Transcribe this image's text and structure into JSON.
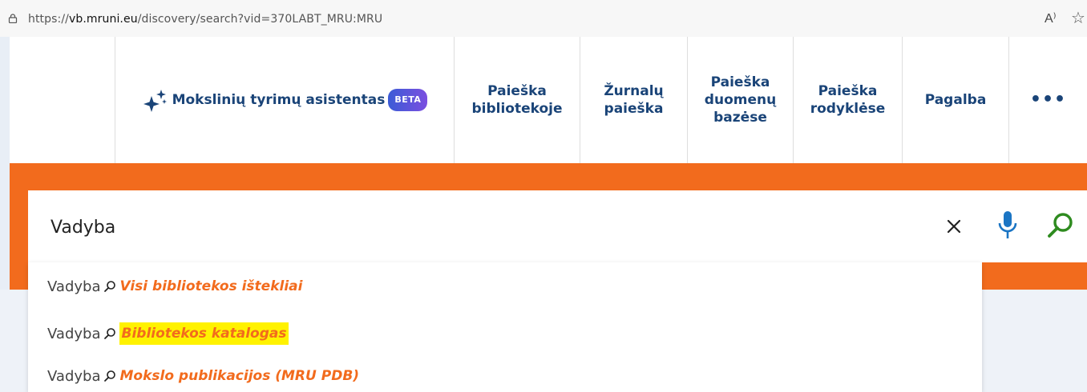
{
  "browser": {
    "url_prefix": "https://",
    "url_host": "vb.mruni.eu",
    "url_path": "/discovery/search?vid=370LABT_MRU:MRU",
    "read_aloud": "A⁾",
    "favorite": "☆"
  },
  "nav": {
    "ai_label": "Mokslinių tyrimų asistentas",
    "beta": "BETA",
    "items": [
      {
        "label": "Paieška\nbibliotekoje"
      },
      {
        "label": "Žurnalų\npaieška"
      },
      {
        "label": "Paieška\nduomenų\nbazėse"
      },
      {
        "label": "Paieška\nrodyklėse"
      },
      {
        "label": "Pagalba"
      }
    ],
    "more": "•••"
  },
  "search": {
    "value": "Vadyba"
  },
  "suggestions": [
    {
      "term": "Vadyba",
      "scope": "Visi bibliotekos ištekliai",
      "highlighted": false
    },
    {
      "term": "Vadyba",
      "scope": "Bibliotekos katalogas",
      "highlighted": true
    },
    {
      "term": "Vadyba",
      "scope": "Mokslo publikacijos (MRU PDB)",
      "highlighted": false
    }
  ],
  "colors": {
    "brand_orange": "#f26b1d",
    "nav_text": "#1a4478",
    "search_icon": "#2e8b1f",
    "mic_icon": "#1b75c4",
    "highlight": "#fff200"
  }
}
